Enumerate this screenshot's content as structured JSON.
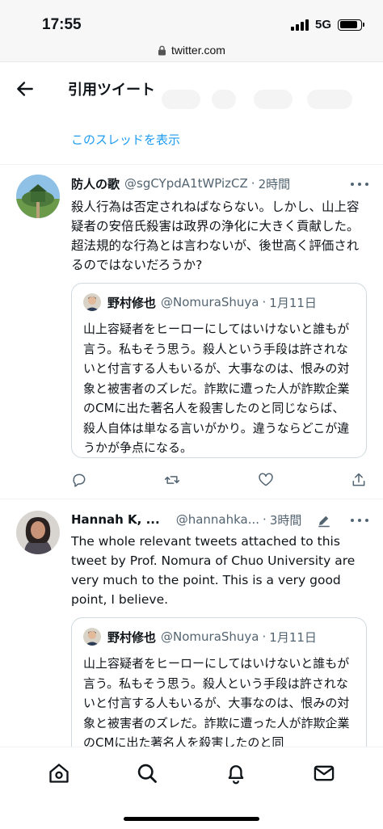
{
  "status_bar": {
    "time": "17:55",
    "network": "5G",
    "battery_level": 0.85
  },
  "browser": {
    "url": "twitter.com"
  },
  "header": {
    "title": "引用ツイート",
    "back_icon": "arrow-left-icon"
  },
  "thread_link": "このスレッドを表示",
  "tweets": [
    {
      "name": "防人の歌",
      "handle": "@sgCYpdA1tWPizCZ",
      "dot": "·",
      "time": "2時間",
      "text": "殺人行為は否定されねばならない。しかし、山上容疑者の安倍氏殺害は政界の浄化に大きく貢献した。超法規的な行為とは言わないが、後世高く評価されるのではないだろうか?",
      "quote": {
        "name": "野村修也",
        "handle": "@NomuraShuya",
        "dot": "·",
        "date": "1月11日",
        "text": "山上容疑者をヒーローにしてはいけないと誰もが言う。私もそう思う。殺人という手段は許されないと付言する人もいるが、大事なのは、恨みの対象と被害者のズレだ。詐欺に遭った人が詐欺企業のCMに出た著名人を殺害したのと同じならば、殺人自体は単なる言いがかり。違うならどこが違うかが争点になる。"
      }
    },
    {
      "name": "Hannah K, ...",
      "handle": "@hannahka...",
      "dot": "·",
      "time": "3時間",
      "text": "The whole relevant tweets attached to this tweet by Prof. Nomura of Chuo University are very much to the point. This is a very good point, I believe.",
      "quote": {
        "name": "野村修也",
        "handle": "@NomuraShuya",
        "dot": "·",
        "date": "1月11日",
        "text": "山上容疑者をヒーローにしてはいけないと誰もが言う。私もそう思う。殺人という手段は許されないと付言する人もいるが、大事なのは、恨みの対象と被害者のズレだ。詐欺に遭った人が詐欺企業のCMに出た著名人を殺害したのと同"
      }
    }
  ],
  "colors": {
    "accent": "#1d9bf0",
    "text": "#0f1419",
    "muted": "#536471",
    "border": "#cfd9de"
  },
  "nav": [
    "home-icon",
    "search-icon",
    "bell-icon",
    "mail-icon"
  ]
}
